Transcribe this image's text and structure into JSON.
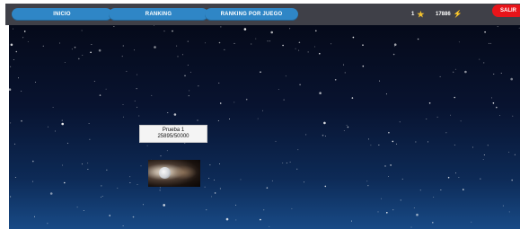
{
  "nav": {
    "inicio_label": "INICIO",
    "ranking_label": "RANKING",
    "ranking_por_juego_label": "RANKING POR JUEGO",
    "salir_label": "SALIR"
  },
  "stats": {
    "stars_count": "1",
    "stars_icon": "star-icon",
    "energy_count": "17886",
    "energy_icon": "bolt-icon"
  },
  "level": {
    "name": "Prueba 1",
    "progress_text": "25895/50000"
  },
  "colors": {
    "topbar": "#3f4048",
    "nav_button": "#2f86c6",
    "logout_button": "#e8141a",
    "icon_gold": "#f2c12e"
  }
}
